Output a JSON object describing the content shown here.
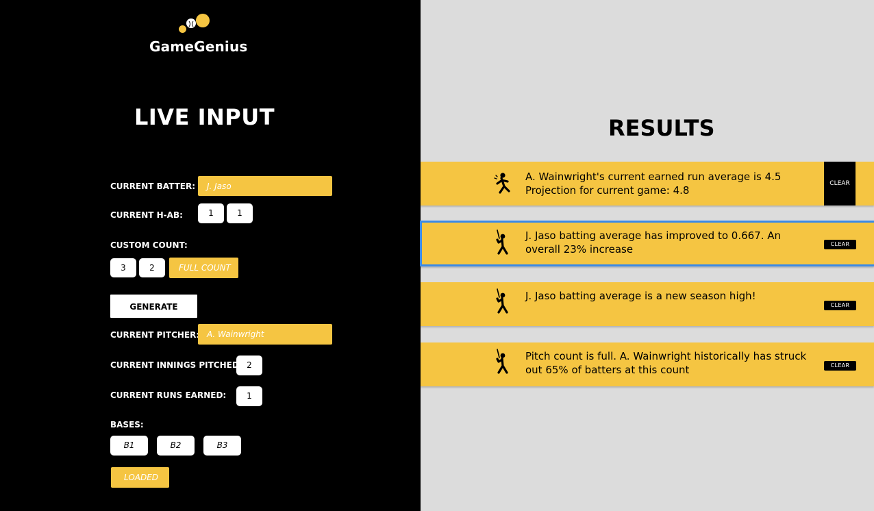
{
  "app": {
    "name": "GameGenius"
  },
  "live_input": {
    "title": "LIVE INPUT",
    "current_batter": {
      "label": "CURRENT BATTER:",
      "value": "J. Jaso"
    },
    "current_hab": {
      "label": "CURRENT H-AB:",
      "hits": "1",
      "at_bats": "1"
    },
    "custom_count": {
      "label": "CUSTOM COUNT:",
      "balls": "3",
      "strikes": "2",
      "full_count_label": "FULL COUNT"
    },
    "generate_label": "GENERATE",
    "current_pitcher": {
      "label": "CURRENT PITCHER:",
      "value": "A. Wainwright"
    },
    "innings_pitched": {
      "label": "CURRENT INNINGS PITCHED:",
      "value": "2"
    },
    "runs_earned": {
      "label": "CURRENT RUNS EARNED:",
      "value": "1"
    },
    "bases": {
      "label": "BASES:",
      "b1": "B1",
      "b2": "B2",
      "b3": "B3",
      "loaded_label": "LOADED"
    }
  },
  "results": {
    "title": "RESULTS",
    "items": [
      {
        "icon": "pitcher-icon",
        "line1": "A. Wainwright's current earned run average is 4.5",
        "line2": "Projection for current game: 4.8",
        "clear_label": "CLEAR"
      },
      {
        "icon": "batter-icon",
        "line1": "J. Jaso batting average has improved to 0.667. An",
        "line2": "overall 23% increase",
        "clear_label": "CLEAR"
      },
      {
        "icon": "batter-icon",
        "line1": "J. Jaso batting average is a new season high!",
        "line2": "",
        "clear_label": "CLEAR"
      },
      {
        "icon": "batter-icon",
        "line1": "Pitch count is full. A. Wainwright historically has struck",
        "line2": "out 65% of batters at this count",
        "clear_label": "CLEAR"
      }
    ]
  },
  "colors": {
    "accent": "#f5c542",
    "left_bg": "#000000",
    "right_bg": "#dcdcdc",
    "selection": "#3b8ae6"
  }
}
